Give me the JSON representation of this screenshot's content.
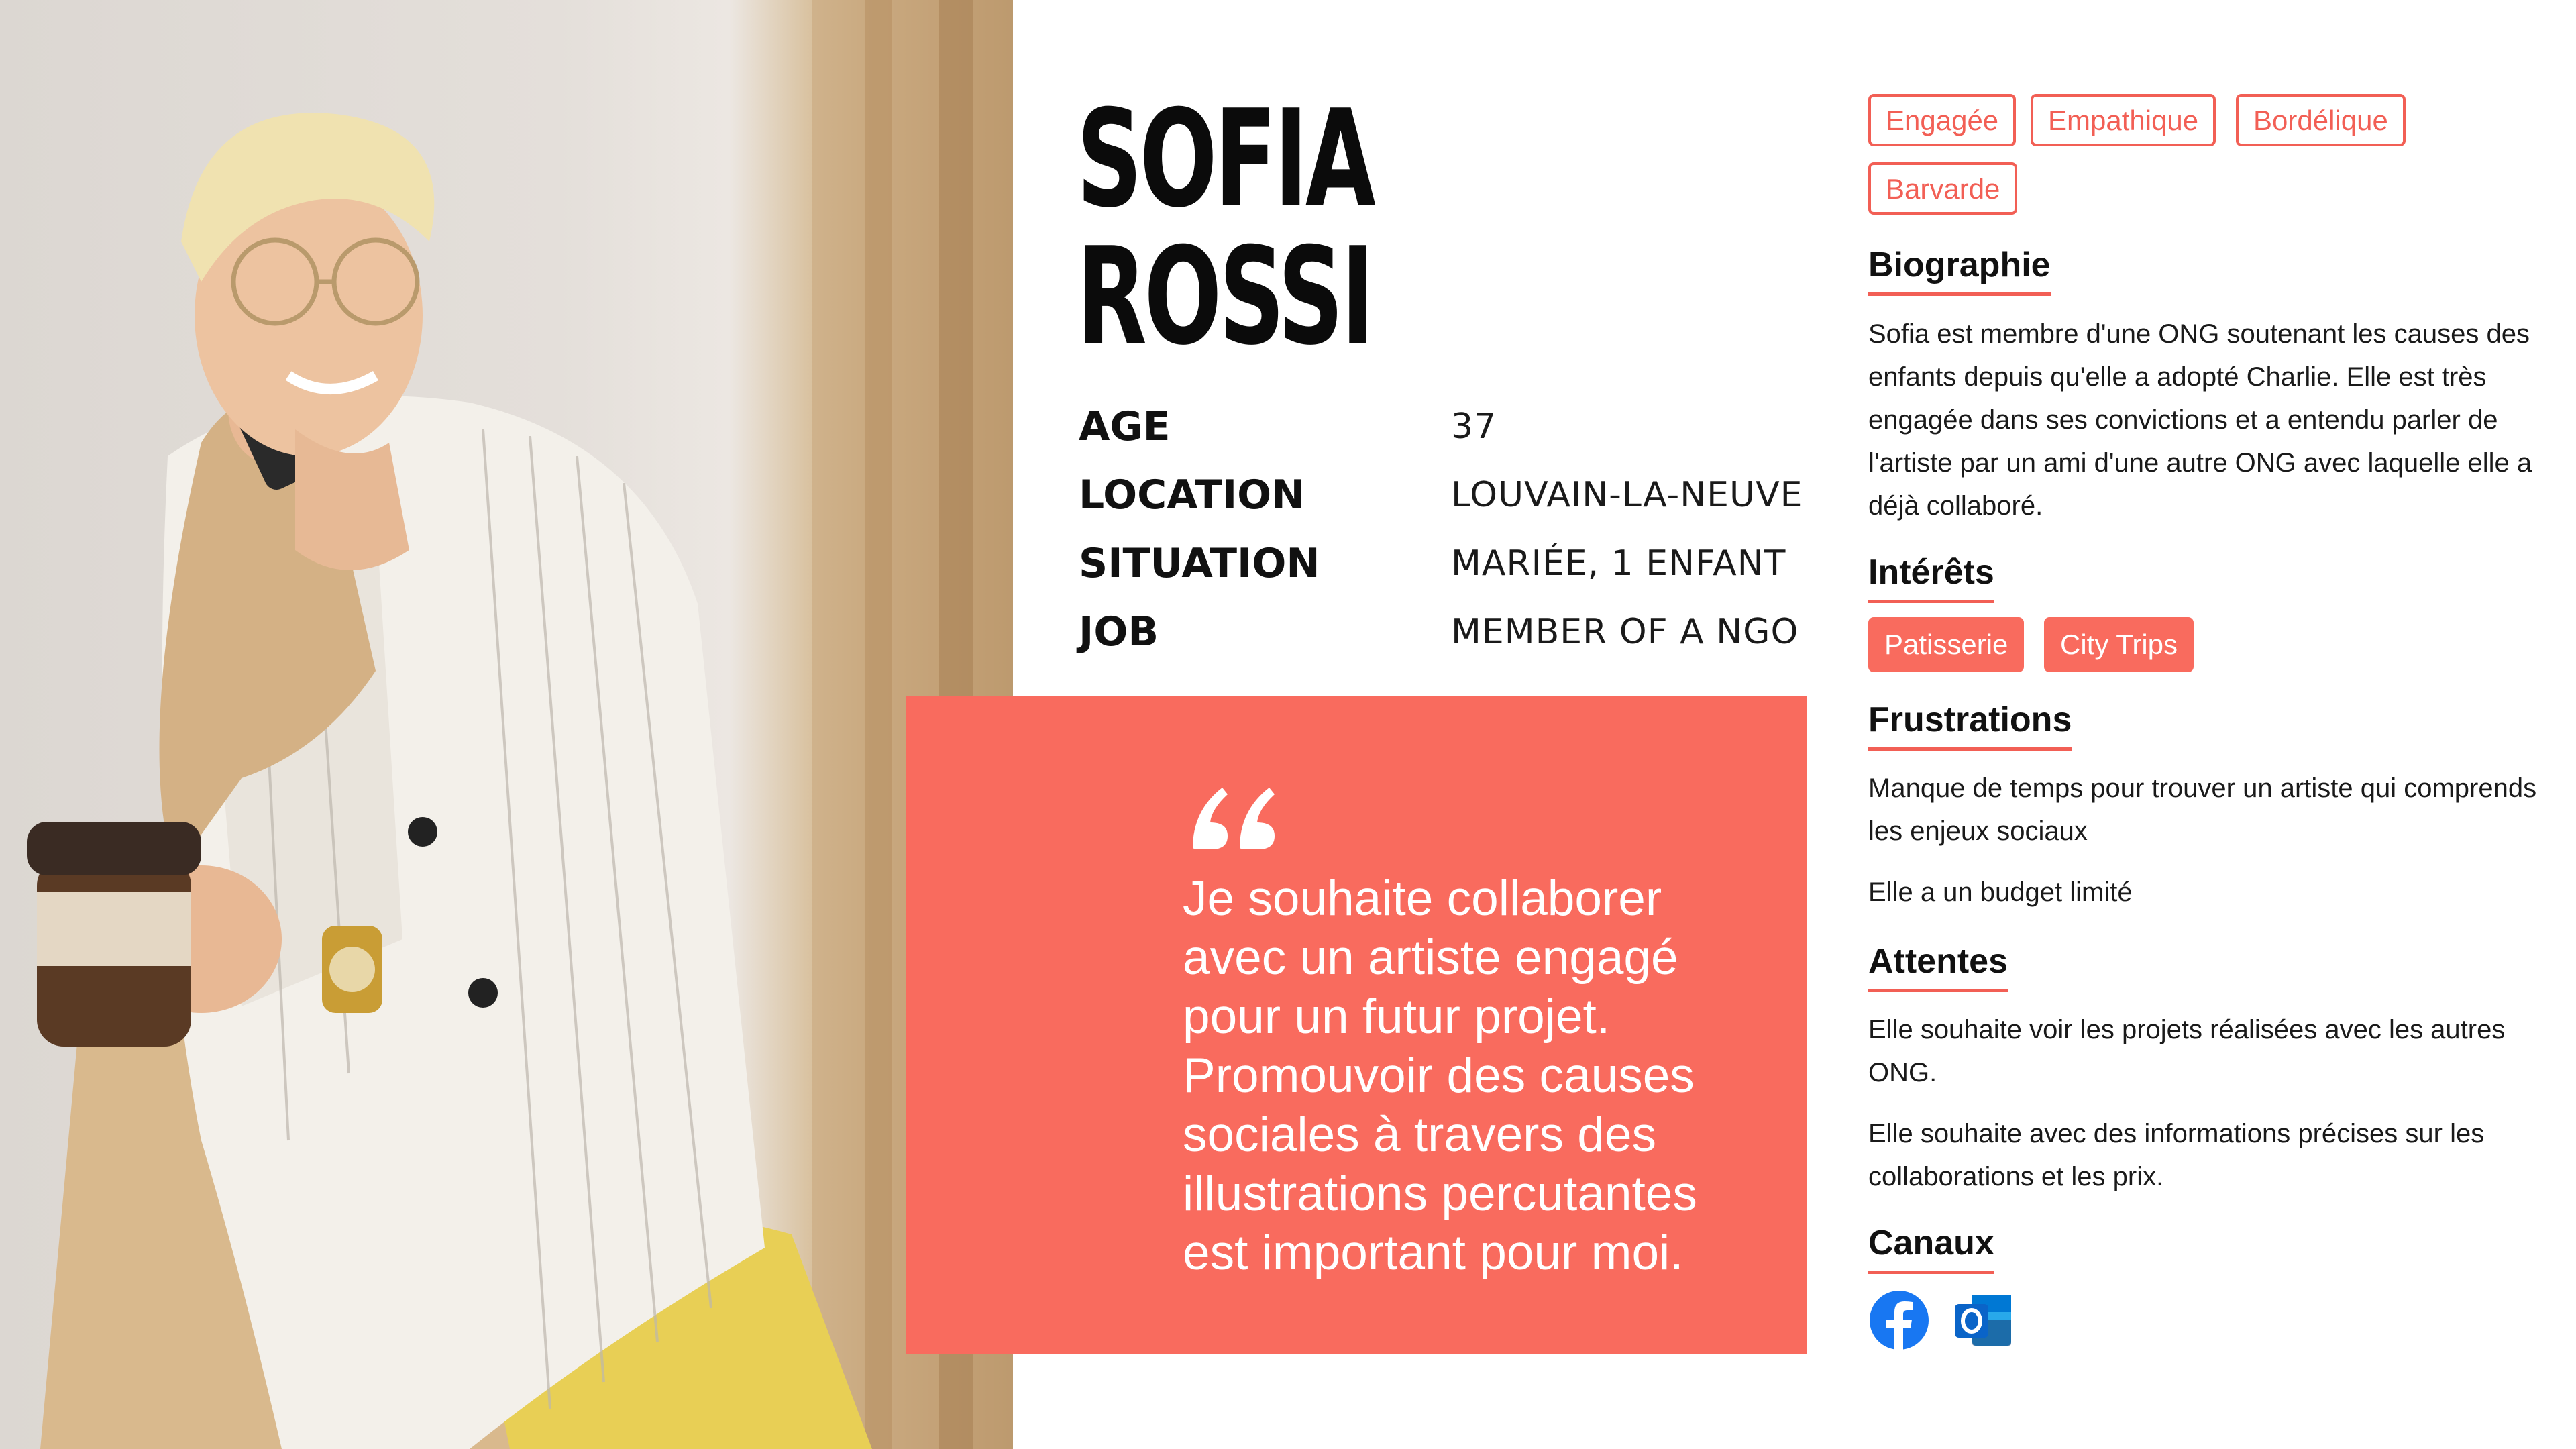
{
  "persona": {
    "first_name": "SOFIA",
    "last_name": "ROSSI",
    "facts": [
      {
        "label": "AGE",
        "value": "37"
      },
      {
        "label": "LOCATION",
        "value": "LOUVAIN-LA-NEUVE"
      },
      {
        "label": "SITUATION",
        "value": "MARIÉE, 1 ENFANT"
      },
      {
        "label": "JOB",
        "value": "MEMBER OF A NGO"
      }
    ]
  },
  "quote": {
    "text": "Je souhaite collaborer avec un artiste engagé pour un futur projet. Promouvoir des causes sociales à travers des illustrations percutantes est important pour moi."
  },
  "traits": [
    "Engagée",
    "Empathique",
    "Bordélique",
    "Barvarde"
  ],
  "biography": {
    "title": "Biographie",
    "text": "Sofia est membre d'une ONG soutenant les causes des enfants depuis qu'elle a adopté Charlie. Elle est très engagée dans ses convictions et a entendu parler de l'artiste par un ami d'une autre ONG avec laquelle elle a déjà collaboré."
  },
  "interests": {
    "title": "Intérêts",
    "items": [
      "Patisserie",
      "City Trips"
    ]
  },
  "frustrations": {
    "title": "Frustrations",
    "items": [
      "Manque de temps pour trouver un artiste qui comprends les enjeux sociaux",
      "Elle a un budget limité"
    ]
  },
  "expectations": {
    "title": "Attentes",
    "items": [
      "Elle souhaite voir les projets réalisées avec les autres ONG.",
      "Elle souhaite avec des informations précises sur les collaborations et les prix."
    ]
  },
  "channels": {
    "title": "Canaux",
    "items": [
      {
        "name": "Facebook",
        "icon": "facebook-icon",
        "color": "#1877f2"
      },
      {
        "name": "Outlook",
        "icon": "outlook-icon",
        "color": "#0a64c8"
      }
    ]
  },
  "colors": {
    "accent": "#f96b5e",
    "accent_border": "#f25f55"
  }
}
